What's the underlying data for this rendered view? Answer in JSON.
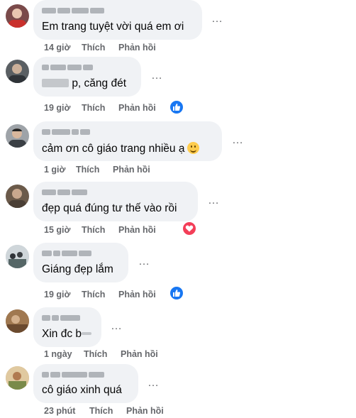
{
  "comments": [
    {
      "text": "Em trang tuyệt vời quá em ơi",
      "time": "14 giờ",
      "like": "Thích",
      "reply": "Phản hồi",
      "reaction": null
    },
    {
      "text": "p, căng đét",
      "time": "19 giờ",
      "like": "Thích",
      "reply": "Phản hồi",
      "reaction": "like"
    },
    {
      "text": "cảm ơn cô giáo trang nhiều ạ",
      "time": "1 giờ",
      "like": "Thích",
      "reply": "Phản hồi",
      "reaction": null
    },
    {
      "text": "đẹp quá đúng tư thế vào rồi",
      "time": "15 giờ",
      "like": "Thích",
      "reply": "Phản hồi",
      "reaction": "love"
    },
    {
      "text": "Giáng đẹp lắm",
      "time": "19 giờ",
      "like": "Thích",
      "reply": "Phản hồi",
      "reaction": "like"
    },
    {
      "text": "Xin đc b",
      "time": "1 ngày",
      "like": "Thích",
      "reply": "Phản hồi",
      "reaction": null
    },
    {
      "text": "cô giáo xinh quá",
      "time": "23 phút",
      "like": "Thích",
      "reply": "Phản hồi",
      "reaction": null
    }
  ],
  "more_icon": "…",
  "colors": {
    "bubble": "#f0f2f5",
    "meta": "#65676b",
    "like": "#1877f2",
    "love": "#f33e58"
  }
}
